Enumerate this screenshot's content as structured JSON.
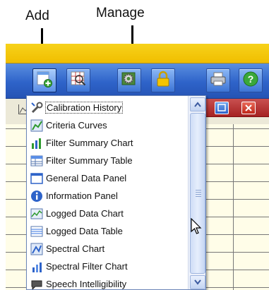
{
  "callouts": {
    "add_label": "Add",
    "manage_label": "Manage"
  },
  "toolbar": {
    "buttons": [
      {
        "name": "add-panel-button",
        "icon": "add-panel-icon"
      },
      {
        "name": "zoom-button",
        "icon": "magnifier-grid-icon"
      },
      {
        "name": "manage-panels-button",
        "icon": "manage-gear-icon"
      },
      {
        "name": "lock-button",
        "icon": "padlock-icon"
      },
      {
        "name": "print-button",
        "icon": "printer-icon"
      },
      {
        "name": "help-button",
        "icon": "help-icon"
      }
    ]
  },
  "dropdown": {
    "items": [
      {
        "label": "Calibration History",
        "icon": "wrench-icon"
      },
      {
        "label": "Criteria Curves",
        "icon": "criteria-chart-icon"
      },
      {
        "label": "Filter Summary Chart",
        "icon": "bar-chart-icon"
      },
      {
        "label": "Filter Summary Table",
        "icon": "table-icon"
      },
      {
        "label": "General Data Panel",
        "icon": "data-panel-icon"
      },
      {
        "label": "Information Panel",
        "icon": "info-icon"
      },
      {
        "label": "Logged Data Chart",
        "icon": "line-chart-icon"
      },
      {
        "label": "Logged Data Table",
        "icon": "data-table-icon"
      },
      {
        "label": "Spectral Chart",
        "icon": "spectral-chart-icon"
      },
      {
        "label": "Spectral Filter Chart",
        "icon": "spectral-filter-icon"
      },
      {
        "label": "Speech Intelligibility",
        "icon": "speech-icon"
      }
    ]
  },
  "colors": {
    "toolbar": "#2e63c9",
    "title_strip": "#f0be00",
    "panel_header": "#a52222"
  }
}
